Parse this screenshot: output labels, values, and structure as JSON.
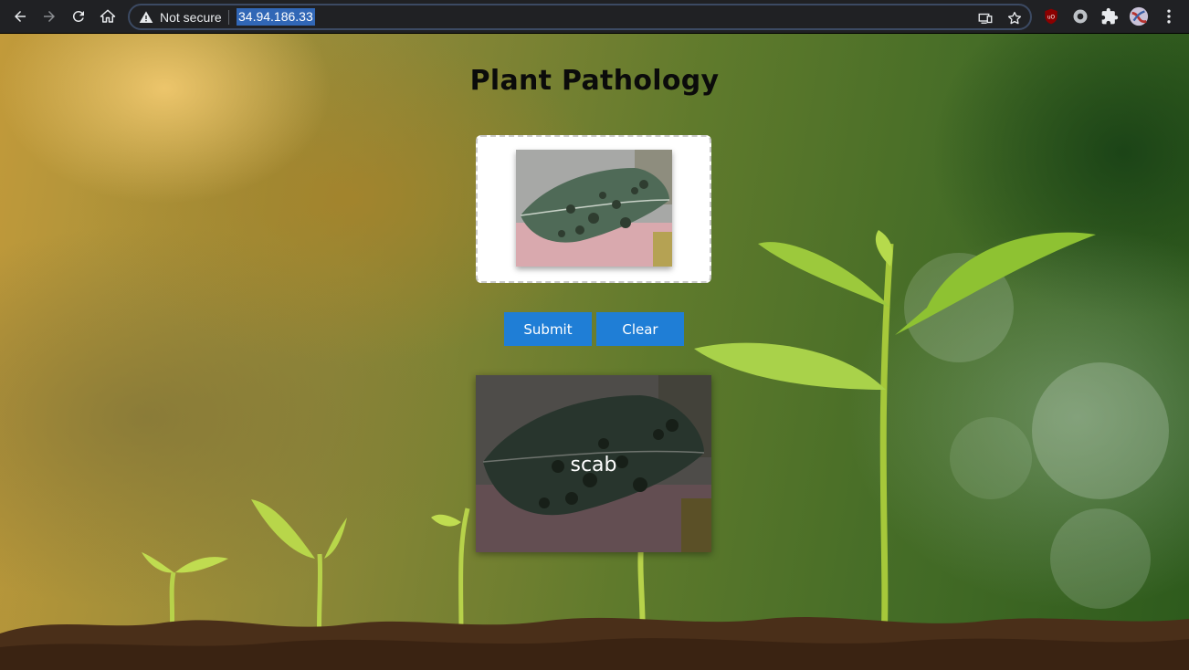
{
  "browser": {
    "security_text": "Not secure",
    "url": "34.94.186.33",
    "icons": [
      "back-icon",
      "forward-icon",
      "reload-icon",
      "home-icon",
      "warning-icon",
      "cast-icon",
      "bookmark-star-icon",
      "ublock-icon",
      "extension-circle-icon",
      "extensions-puzzle-icon",
      "profile-avatar",
      "more-menu-icon"
    ]
  },
  "page": {
    "title": "Plant Pathology",
    "upload": {
      "image_desc": "uploaded leaf thumbnail"
    },
    "buttons": {
      "submit": "Submit",
      "clear": "Clear"
    },
    "result": {
      "label": "scab"
    }
  },
  "colors": {
    "button": "#1f7ed6",
    "chrome_bg": "#202124",
    "url_highlight": "#3167b6"
  }
}
